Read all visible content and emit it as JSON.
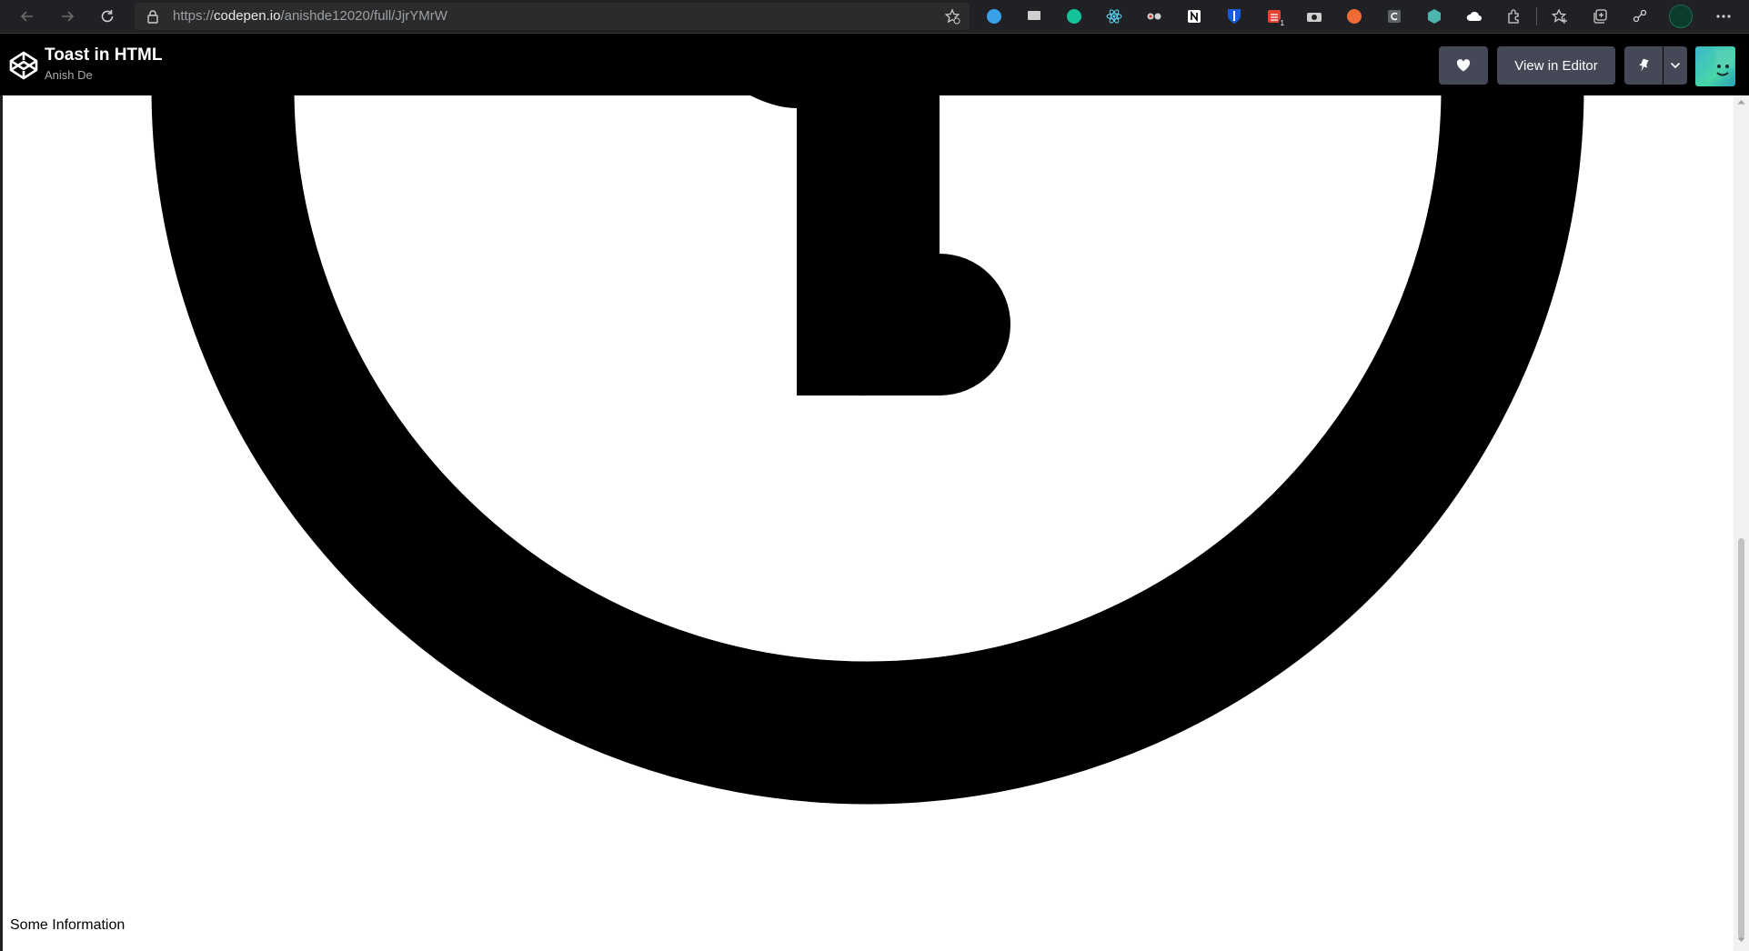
{
  "browser": {
    "url_scheme": "https://",
    "url_host": "codepen.io",
    "url_path": "/anishde12020/full/JjrYMrW"
  },
  "header": {
    "title": "Toast in HTML",
    "author": "Anish De",
    "view_in_editor_label": "View in Editor"
  },
  "main": {
    "info_text": "Some Information"
  },
  "icons": {
    "main_graphic": "clock-icon"
  },
  "colors": {
    "page_background": "#ffffff",
    "graphic": "#000000",
    "header_background": "#000000",
    "header_button": "#444857"
  }
}
